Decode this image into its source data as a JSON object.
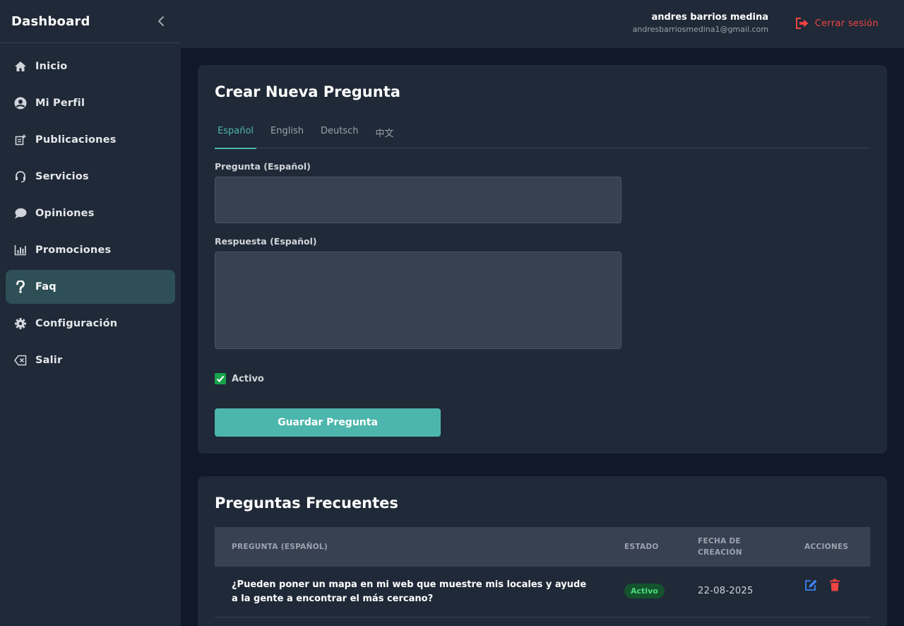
{
  "sidebar": {
    "brand": "Dashboard",
    "items": [
      {
        "label": "Inicio",
        "icon": "home-icon"
      },
      {
        "label": "Mi Perfil",
        "icon": "user-circle-icon"
      },
      {
        "label": "Publicaciones",
        "icon": "post-add-icon"
      },
      {
        "label": "Servicios",
        "icon": "headset-icon"
      },
      {
        "label": "Opiniones",
        "icon": "chat-bubble-icon"
      },
      {
        "label": "Promociones",
        "icon": "bar-chart-icon"
      },
      {
        "label": "Faq",
        "icon": "question-icon",
        "active": true
      },
      {
        "label": "Configuración",
        "icon": "gear-icon"
      },
      {
        "label": "Salir",
        "icon": "backspace-icon"
      }
    ]
  },
  "header": {
    "user_name": "andres barrios medina",
    "user_email": "andresbarriosmedina1@gmail.com",
    "logout_label": "Cerrar sesión"
  },
  "form": {
    "title": "Crear Nueva Pregunta",
    "tabs": [
      "Español",
      "English",
      "Deutsch",
      "中文"
    ],
    "active_tab": "Español",
    "question_label": "Pregunta (Español)",
    "question_value": "",
    "answer_label": "Respuesta (Español)",
    "answer_value": "",
    "active_label": "Activo",
    "active_checked": true,
    "save_label": "Guardar Pregunta"
  },
  "faq_list": {
    "title": "Preguntas Frecuentes",
    "columns": {
      "question": "Pregunta (Español)",
      "status": "Estado",
      "created_line1": "Fecha de",
      "created_line2": "creación",
      "actions": "Acciones"
    },
    "rows": [
      {
        "question": "¿Pueden poner un mapa en mi web que muestre mis locales y ayude a la gente a encontrar el más cercano?",
        "status": "Activo",
        "date": "22-08-2025"
      }
    ]
  },
  "colors": {
    "accent": "#4db6ac",
    "danger": "#ef4444",
    "success": "#16a34a",
    "edit": "#3b82f6"
  }
}
